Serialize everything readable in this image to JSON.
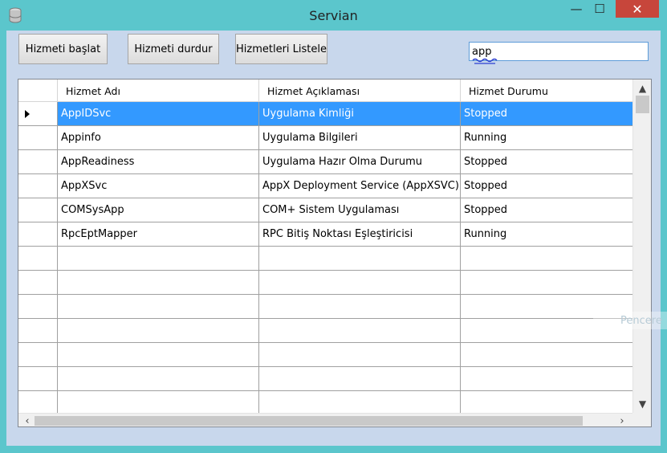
{
  "window": {
    "title": "Servian",
    "min_glyph": "—",
    "max_glyph": "☐",
    "close_glyph": "✕"
  },
  "toolbar": {
    "start_label": "Hizmeti başlat",
    "stop_label": "Hizmeti durdur",
    "list_label": "Hizmetleri Listele"
  },
  "search": {
    "value": "app",
    "placeholder": ""
  },
  "grid": {
    "columns": [
      "Hizmet Adı",
      "Hizmet Açıklaması",
      "Hizmet Durumu"
    ],
    "rows": [
      {
        "name": "AppIDSvc",
        "description": "Uygulama Kimliği",
        "status": "Stopped"
      },
      {
        "name": "Appinfo",
        "description": "Uygulama Bilgileri",
        "status": "Running"
      },
      {
        "name": "AppReadiness",
        "description": "Uygulama Hazır Olma Durumu",
        "status": "Stopped"
      },
      {
        "name": "AppXSvc",
        "description": "AppX Deployment Service (AppXSVC)",
        "status": "Stopped"
      },
      {
        "name": "COMSysApp",
        "description": "COM+ Sistem Uygulaması",
        "status": "Stopped"
      },
      {
        "name": "RpcEptMapper",
        "description": "RPC Bitiş Noktası Eşleştiricisi",
        "status": "Running"
      }
    ],
    "empty_rows": 7,
    "selected_row": 0
  },
  "overlay": {
    "text": "Pencere"
  },
  "colors": {
    "frame": "#5bc6cc",
    "client": "#c8d7ec",
    "selection": "#3399ff",
    "close": "#c7463b"
  }
}
